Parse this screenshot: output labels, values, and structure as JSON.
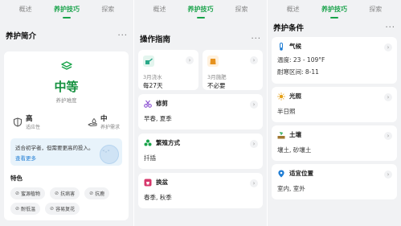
{
  "tabs": [
    "概述",
    "养护技巧",
    "探索"
  ],
  "active_tab_index": 1,
  "accent_color": "#19a34a",
  "panel1": {
    "section_title": "养护简介",
    "more": "···",
    "difficulty_icon": "layers-icon",
    "difficulty_value": "中等",
    "difficulty_label": "养护难度",
    "adaptability": {
      "icon": "shield-icon",
      "value": "高",
      "label": "适应性"
    },
    "care_need": {
      "icon": "hand-water-icon",
      "value": "中",
      "label": "养护需求"
    },
    "tip_text": "适合初学者，但需要更高的投入。",
    "tip_link": "查看更多",
    "features_title": "特色",
    "features": [
      "蜜源植物",
      "抗病害",
      "抗鹿",
      "耐低温",
      "容易复花"
    ]
  },
  "panel2": {
    "section_title": "操作指南",
    "more": "···",
    "watering": {
      "icon": "watering-can-icon",
      "line1": "3月浇水",
      "line2": "每27天"
    },
    "fertilizing": {
      "icon": "fertilizer-icon",
      "line1": "3月施肥",
      "line2": "不必要"
    },
    "rows": [
      {
        "icon": "scissors-icon",
        "title": "修剪",
        "value": "早春, 夏季",
        "color": "#8a4fd1"
      },
      {
        "icon": "propagation-icon",
        "title": "繁殖方式",
        "value": "扦插",
        "color": "#19a34a"
      },
      {
        "icon": "repot-icon",
        "title": "换盆",
        "value": "春季, 秋季",
        "color": "#d6376b"
      }
    ]
  },
  "panel3": {
    "section_title": "养护条件",
    "more": "···",
    "climate": {
      "icon": "thermometer-icon",
      "title": "气候",
      "line1": "温度: 23 - 109°F",
      "line2": "耐寒区间: 8-11"
    },
    "rows": [
      {
        "icon": "sun-icon",
        "title": "光照",
        "value": "半日照",
        "color": "#e6a11a"
      },
      {
        "icon": "soil-icon",
        "title": "土壤",
        "value": "壤土, 砂壤土",
        "color": "#a0772f"
      },
      {
        "icon": "location-icon",
        "title": "适宜位置",
        "value": "室内, 室外",
        "color": "#1f7dd4"
      }
    ]
  }
}
